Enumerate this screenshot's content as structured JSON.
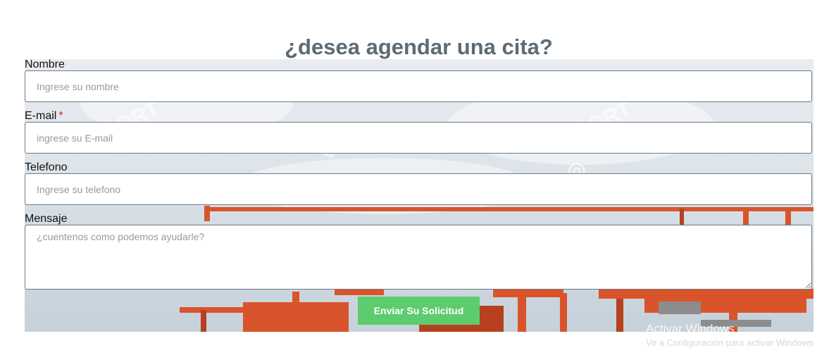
{
  "heading": "¿desea agendar una cita?",
  "form": {
    "name": {
      "label": "Nombre",
      "placeholder": "Ingrese su nombre"
    },
    "email": {
      "label": "E-mail",
      "required_mark": "*",
      "placeholder": "ingrese su E-mail"
    },
    "phone": {
      "label": "Telefono",
      "placeholder": "Ingrese su telefono"
    },
    "message": {
      "label": "Mensaje",
      "placeholder": "¿cuentenos como podemos ayudarle?"
    },
    "submit_label": "Enviar Su Solicitud"
  },
  "windows_activation": {
    "line1": "Activar Windows",
    "line2": "Ve a Configuración para activar Windows"
  },
  "colors": {
    "heading": "#5c6b75",
    "button": "#5dcc6e",
    "required": "#e01b1b",
    "crane": "#d9542b"
  }
}
